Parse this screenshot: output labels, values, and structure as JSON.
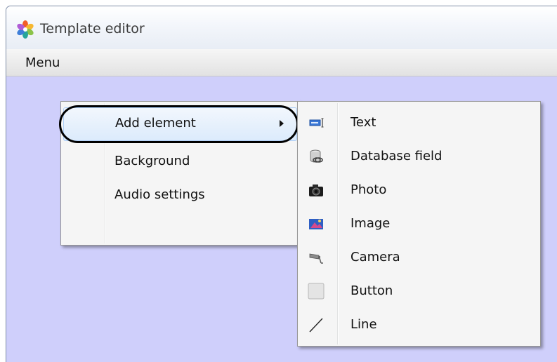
{
  "window": {
    "title": "Template editor",
    "app_icon": "template-editor-logo-icon"
  },
  "menubar": {
    "items": [
      {
        "label": "Menu"
      }
    ]
  },
  "context_menu": {
    "items": [
      {
        "label": "Add element",
        "has_submenu": true,
        "selected": true
      },
      {
        "label": "Background"
      },
      {
        "label": "Audio settings"
      }
    ]
  },
  "submenu": {
    "items": [
      {
        "label": "Text",
        "icon": "text-icon"
      },
      {
        "label": "Database field",
        "icon": "database-field-icon"
      },
      {
        "label": "Photo",
        "icon": "photo-camera-icon"
      },
      {
        "label": "Image",
        "icon": "image-icon"
      },
      {
        "label": "Camera",
        "icon": "surveillance-camera-icon"
      },
      {
        "label": "Button",
        "icon": "button-icon"
      },
      {
        "label": "Line",
        "icon": "line-icon"
      }
    ]
  },
  "colors": {
    "workspace_background": "#cfcffb",
    "menu_background": "#f5f5f5",
    "selection_border": "#aecff7"
  }
}
